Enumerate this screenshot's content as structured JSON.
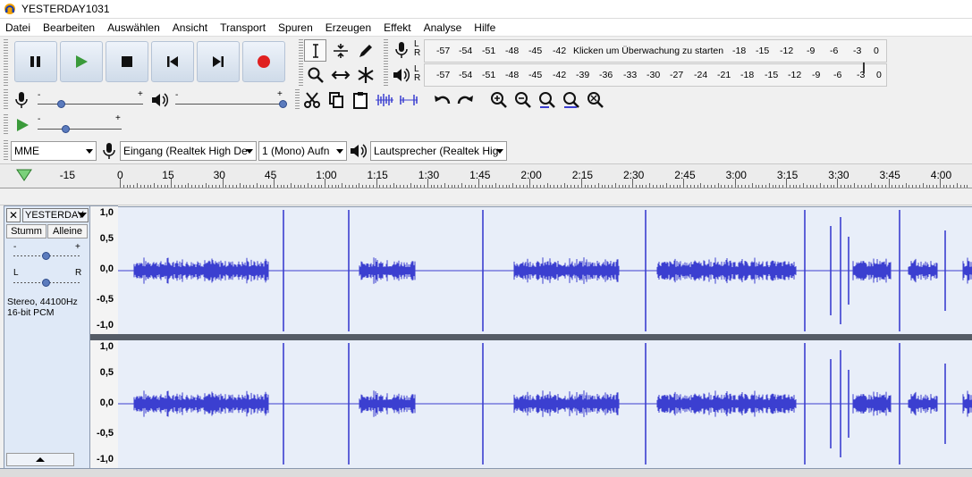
{
  "window": {
    "title": "YESTERDAY1031"
  },
  "menu": [
    "Datei",
    "Bearbeiten",
    "Ansicht",
    "Auswählen",
    "Transport",
    "Spuren",
    "Erzeugen",
    "Effekt",
    "Analyse",
    "Hilfe"
  ],
  "menu_order": [
    "Datei",
    "Bearbeiten",
    "Auswählen",
    "Ansicht",
    "Transport",
    "Spuren",
    "Erzeugen",
    "Effekt",
    "Analyse",
    "Hilfe"
  ],
  "transport": {
    "pause": "pause-icon",
    "play": "play-icon",
    "stop": "stop-icon",
    "skip_start": "skip-start-icon",
    "skip_end": "skip-end-icon",
    "record": "record-icon"
  },
  "meters": {
    "record_scale": [
      "-57",
      "-54",
      "-51",
      "-48",
      "-45",
      "-42"
    ],
    "record_hint": "Klicken um Überwachung zu starten",
    "record_scale_right": [
      "-18",
      "-15",
      "-12",
      "-9",
      "-6",
      "-3",
      "0"
    ],
    "play_scale": [
      "-57",
      "-54",
      "-51",
      "-48",
      "-45",
      "-42",
      "-39",
      "-36",
      "-33",
      "-30",
      "-27",
      "-24",
      "-21",
      "-18",
      "-15",
      "-12",
      "-9",
      "-6",
      "-3",
      "0"
    ],
    "L": "L",
    "R": "R"
  },
  "mixer": {
    "minus": "-",
    "plus": "+"
  },
  "devices": {
    "host": "MME",
    "input": "Eingang (Realtek High De",
    "channels": "1 (Mono) Aufn",
    "output": "Lautsprecher (Realtek Hig"
  },
  "timeline": {
    "ticks": [
      "-15",
      "0",
      "15",
      "30",
      "45",
      "1:00",
      "1:15",
      "1:30",
      "1:45",
      "2:00",
      "2:15",
      "2:30",
      "2:45",
      "3:00",
      "3:15",
      "3:30",
      "3:45",
      "4:00"
    ]
  },
  "track": {
    "name": "YESTERDAY",
    "mute": "Stumm",
    "solo": "Alleine",
    "gain_minus": "-",
    "gain_plus": "+",
    "pan_left": "L",
    "pan_right": "R",
    "info1": "Stereo, 44100Hz",
    "info2": "16-bit PCM",
    "yaxis": [
      "1,0",
      "0,5",
      "0,0",
      "-0,5",
      "-1,0"
    ]
  },
  "colors": {
    "wave": "#3b3fd0",
    "wave_bg": "#e8eef9",
    "accent_play": "#3a9a3a",
    "record": "#e02020"
  }
}
